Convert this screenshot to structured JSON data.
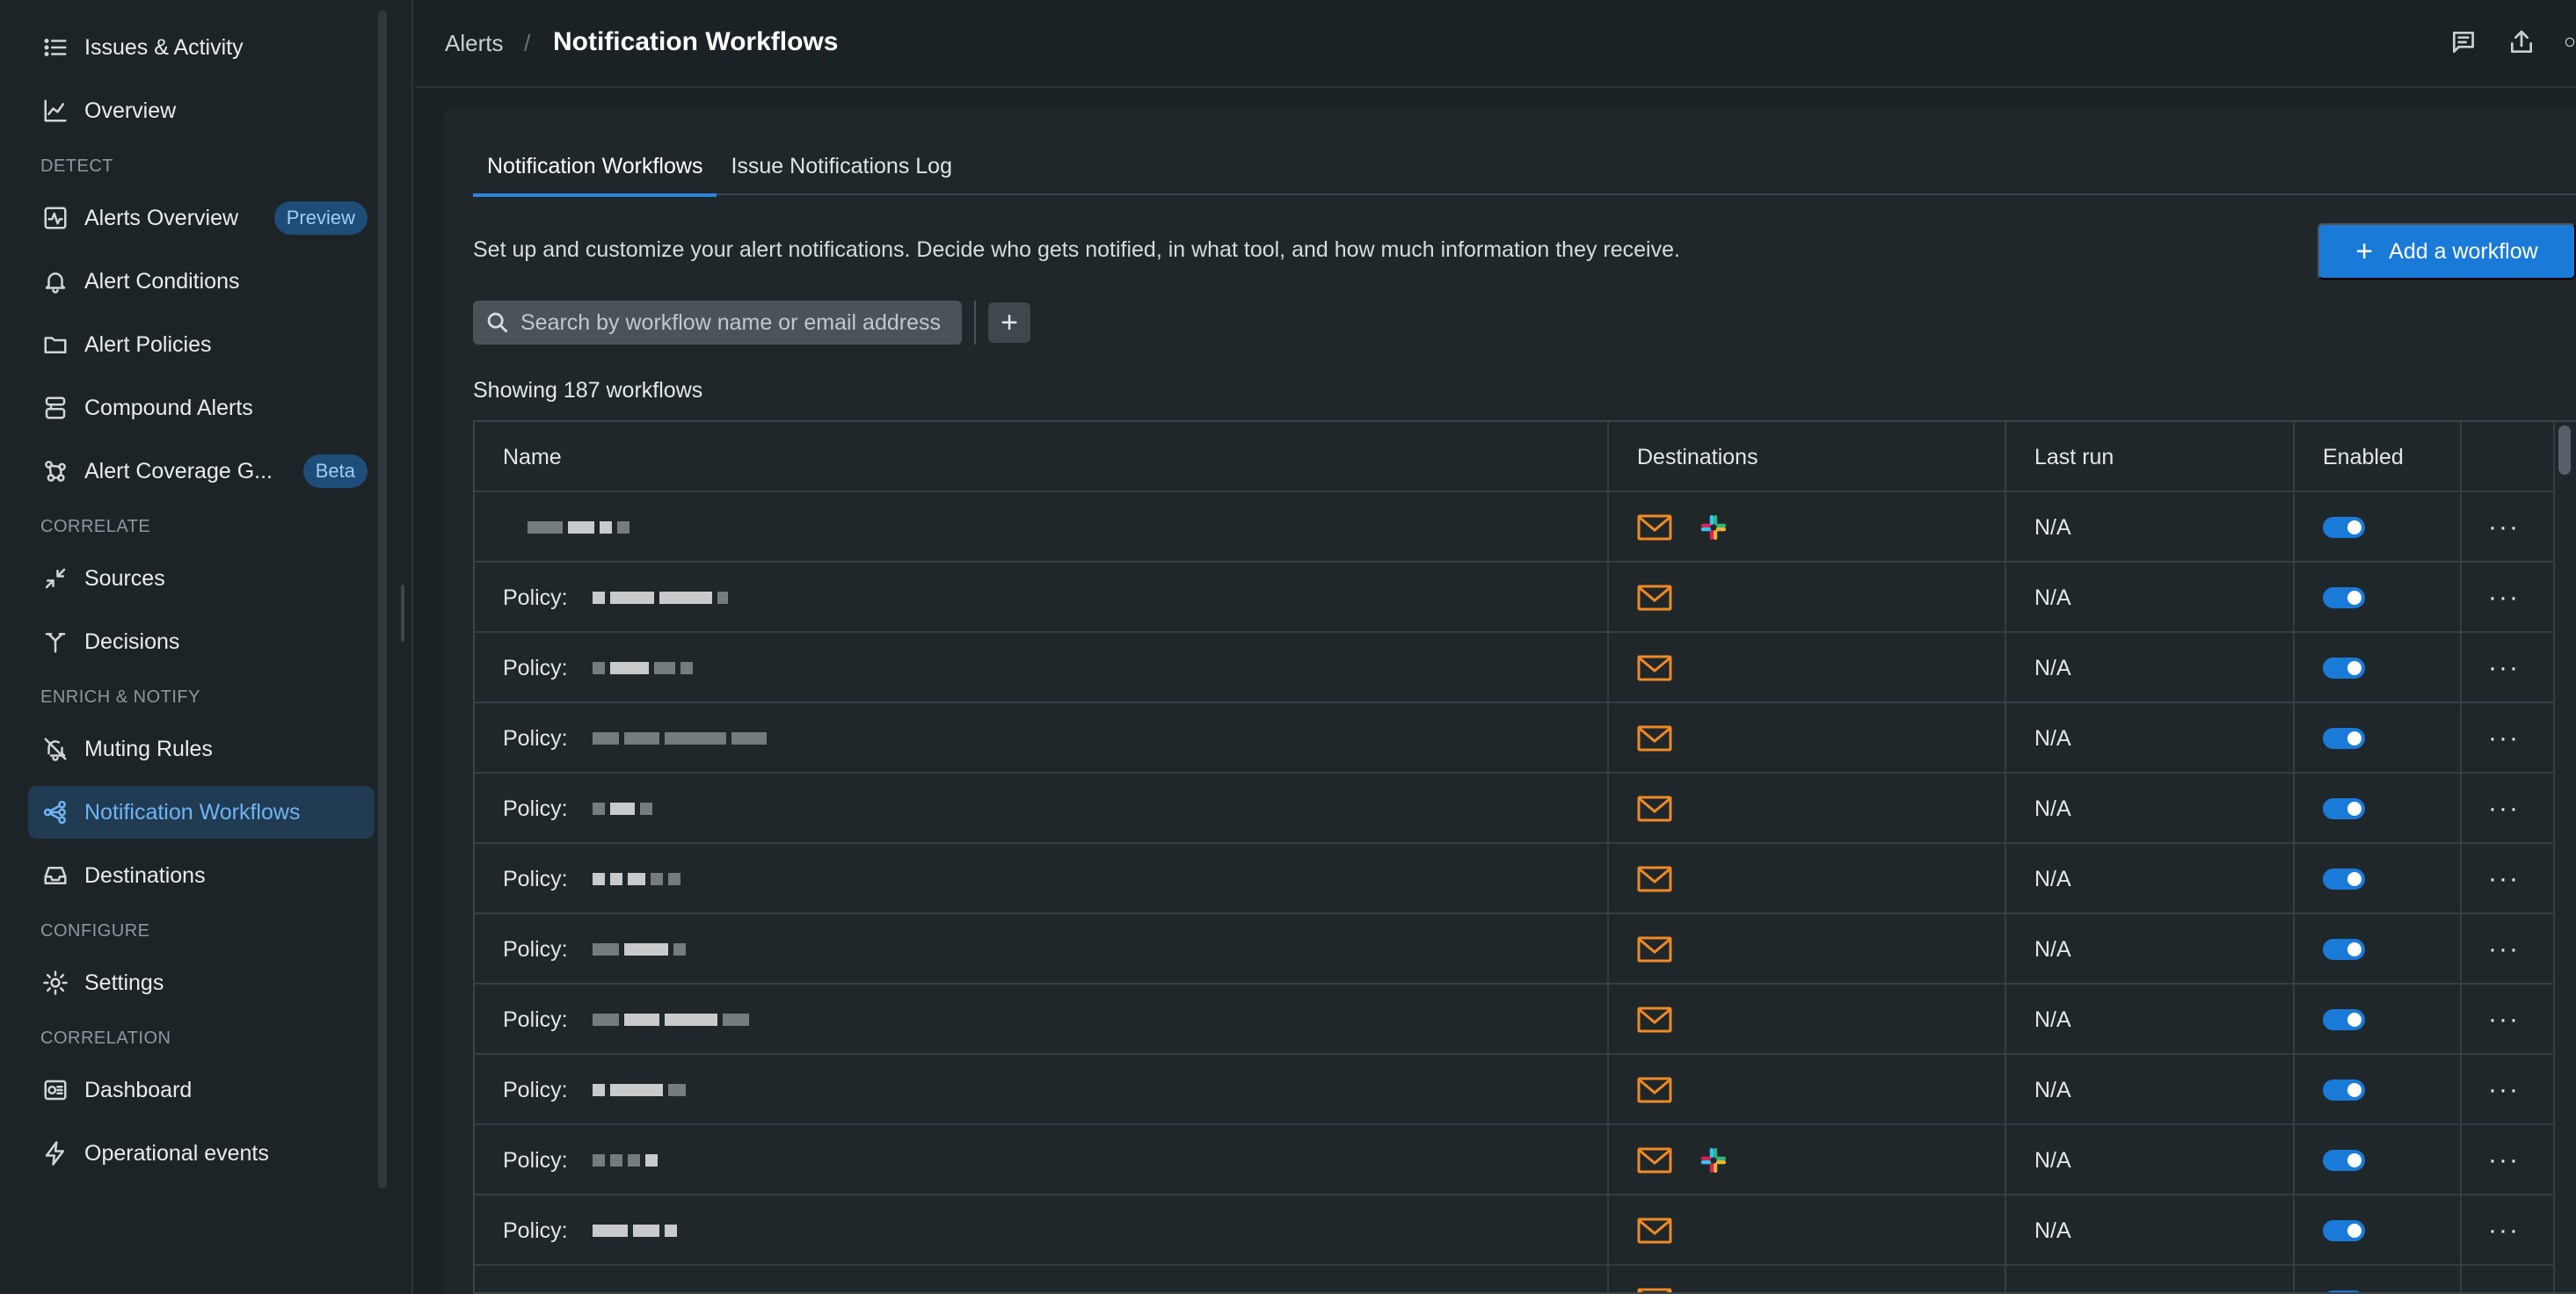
{
  "sidebar": {
    "top_items": [
      {
        "label": "Issues & Activity",
        "icon": "list-icon"
      },
      {
        "label": "Overview",
        "icon": "chart-icon"
      }
    ],
    "sections": [
      {
        "title": "DETECT",
        "items": [
          {
            "label": "Alerts Overview",
            "icon": "activity-icon",
            "badge": "Preview"
          },
          {
            "label": "Alert Conditions",
            "icon": "bell-icon"
          },
          {
            "label": "Alert Policies",
            "icon": "folder-icon"
          },
          {
            "label": "Compound Alerts",
            "icon": "compound-icon"
          },
          {
            "label": "Alert Coverage G...",
            "icon": "coverage-icon",
            "badge": "Beta"
          }
        ]
      },
      {
        "title": "CORRELATE",
        "items": [
          {
            "label": "Sources",
            "icon": "arrows-in-icon"
          },
          {
            "label": "Decisions",
            "icon": "split-icon"
          }
        ]
      },
      {
        "title": "ENRICH & NOTIFY",
        "items": [
          {
            "label": "Muting Rules",
            "icon": "bell-off-icon"
          },
          {
            "label": "Notification Workflows",
            "icon": "workflow-icon",
            "active": true
          },
          {
            "label": "Destinations",
            "icon": "inbox-icon"
          }
        ]
      },
      {
        "title": "CONFIGURE",
        "items": [
          {
            "label": "Settings",
            "icon": "gear-icon"
          }
        ]
      },
      {
        "title": "CORRELATION",
        "items": [
          {
            "label": "Dashboard",
            "icon": "dashboard-icon"
          },
          {
            "label": "Operational events",
            "icon": "bolt-icon"
          }
        ]
      }
    ]
  },
  "header": {
    "breadcrumb": "Alerts",
    "separator": "/",
    "title": "Notification Workflows"
  },
  "tabs": [
    {
      "label": "Notification Workflows",
      "active": true
    },
    {
      "label": "Issue Notifications Log",
      "active": false
    }
  ],
  "description": "Set up and customize your alert notifications. Decide who gets notified, in what tool, and how much information they receive.",
  "add_button": "Add a workflow",
  "search": {
    "placeholder": "Search by workflow name or email address"
  },
  "showing": "Showing 187 workflows",
  "table": {
    "columns": [
      "Name",
      "Destinations",
      "Last run",
      "Enabled"
    ],
    "rows": [
      {
        "name": "",
        "destinations": [
          "email",
          "slack"
        ],
        "last_run": "N/A",
        "enabled": true
      },
      {
        "name": "Policy:",
        "destinations": [
          "email"
        ],
        "last_run": "N/A",
        "enabled": true
      },
      {
        "name": "Policy:",
        "destinations": [
          "email"
        ],
        "last_run": "N/A",
        "enabled": true
      },
      {
        "name": "Policy:",
        "destinations": [
          "email"
        ],
        "last_run": "N/A",
        "enabled": true
      },
      {
        "name": "Policy:",
        "destinations": [
          "email"
        ],
        "last_run": "N/A",
        "enabled": true
      },
      {
        "name": "Policy:",
        "destinations": [
          "email"
        ],
        "last_run": "N/A",
        "enabled": true
      },
      {
        "name": "Policy:",
        "destinations": [
          "email"
        ],
        "last_run": "N/A",
        "enabled": true
      },
      {
        "name": "Policy:",
        "destinations": [
          "email"
        ],
        "last_run": "N/A",
        "enabled": true
      },
      {
        "name": "Policy:",
        "destinations": [
          "email"
        ],
        "last_run": "N/A",
        "enabled": true
      },
      {
        "name": "Policy:",
        "destinations": [
          "email",
          "slack"
        ],
        "last_run": "N/A",
        "enabled": true
      },
      {
        "name": "Policy:",
        "destinations": [
          "email"
        ],
        "last_run": "N/A",
        "enabled": true
      },
      {
        "name": "",
        "destinations": [
          "email"
        ],
        "last_run": "",
        "enabled": true
      }
    ]
  },
  "colors": {
    "accent": "#1a7ad8",
    "active_nav": "#6fb4f5",
    "mail_icon": "#f08a24"
  }
}
